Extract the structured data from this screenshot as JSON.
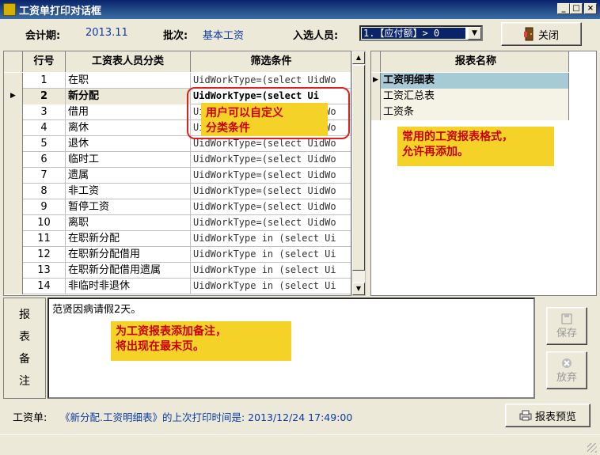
{
  "window": {
    "title": "工资单打印对话框",
    "min": "_",
    "max": "□",
    "close": "×"
  },
  "header": {
    "period_label": "会计期:",
    "period_value": "2013.11",
    "batch_label": "批次:",
    "batch_value": "基本工资",
    "select_label": "入选人员:",
    "select_value": "1.【应付额】> 0",
    "close_button": "关闭"
  },
  "grid": {
    "columns": [
      "行号",
      "工资表人员分类",
      "筛选条件"
    ],
    "rows": [
      {
        "num": "1",
        "category": "在职",
        "condition": "UidWorkType=(select UidWo"
      },
      {
        "num": "2",
        "category": "新分配",
        "condition": "UidWorkType=(select Ui"
      },
      {
        "num": "3",
        "category": "借用",
        "condition": "UidWorkType=(select UidWo"
      },
      {
        "num": "4",
        "category": "离休",
        "condition": "UidWorkType=(select UidWo"
      },
      {
        "num": "5",
        "category": "退休",
        "condition": "UidWorkType=(select UidWo"
      },
      {
        "num": "6",
        "category": "临时工",
        "condition": "UidWorkType=(select UidWo"
      },
      {
        "num": "7",
        "category": "遗属",
        "condition": "UidWorkType=(select UidWo"
      },
      {
        "num": "8",
        "category": "非工资",
        "condition": "UidWorkType=(select UidWo"
      },
      {
        "num": "9",
        "category": "暂停工资",
        "condition": "UidWorkType=(select UidWo"
      },
      {
        "num": "10",
        "category": "离职",
        "condition": "UidWorkType=(select UidWo"
      },
      {
        "num": "11",
        "category": "在职新分配",
        "condition": "UidWorkType in (select Ui"
      },
      {
        "num": "12",
        "category": "在职新分配借用",
        "condition": "UidWorkType in (select Ui"
      },
      {
        "num": "13",
        "category": "在职新分配借用遗属",
        "condition": "UidWorkType in (select Ui"
      },
      {
        "num": "14",
        "category": "非临时非退休",
        "condition": "UidWorkType in (select Ui"
      }
    ],
    "selected_index": 1
  },
  "reports": {
    "column": "报表名称",
    "items": [
      "工资明细表",
      "工资汇总表",
      "工资条"
    ],
    "selected_index": 0
  },
  "notes": {
    "label_chars": [
      "报",
      "表",
      "备",
      "注"
    ],
    "text": "范贤因病请假2天。",
    "save_button": "保存",
    "discard_button": "放弃"
  },
  "annotations": {
    "custom_condition": "用户可以自定义\n分类条件",
    "report_formats": "常用的工资报表格式，\n允许再添加。",
    "add_remark": "为工资报表添加备注，\n将出现在最末页。"
  },
  "footer": {
    "label": "工资单:",
    "last_print": "《新分配.工资明细表》的上次打印时间是: 2013/12/24 17:49:00",
    "preview_button": "报表预览"
  },
  "colors": {
    "title_bar": "#0a246a",
    "value_text": "#0b3aa5",
    "annotation_bg": "#f5d228",
    "annotation_text": "#cc0000",
    "selected_report": "#a6cad6",
    "highlight_border": "#e02020"
  }
}
